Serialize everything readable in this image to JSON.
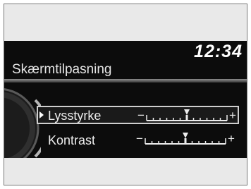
{
  "screen": {
    "clock": "12:34",
    "title": "Skærmtilpasning"
  },
  "settings": [
    {
      "label": "Lysstyrke",
      "selected": true,
      "decrease_symbol": "−",
      "increase_symbol": "+",
      "level": 0.5
    },
    {
      "label": "Kontrast",
      "selected": false,
      "decrease_symbol": "−",
      "increase_symbol": "+",
      "level": 0.5
    }
  ],
  "colors": {
    "screen_background": "#0c0c0c",
    "text": "#ececec",
    "highlight_border": "#cfcfcf",
    "frame_background": "#e9e9e9"
  },
  "icons": {
    "selector_dial": "interface-dial-icon",
    "pointer": "selection-pointer-icon",
    "level_marker": "level-marker-icon"
  }
}
